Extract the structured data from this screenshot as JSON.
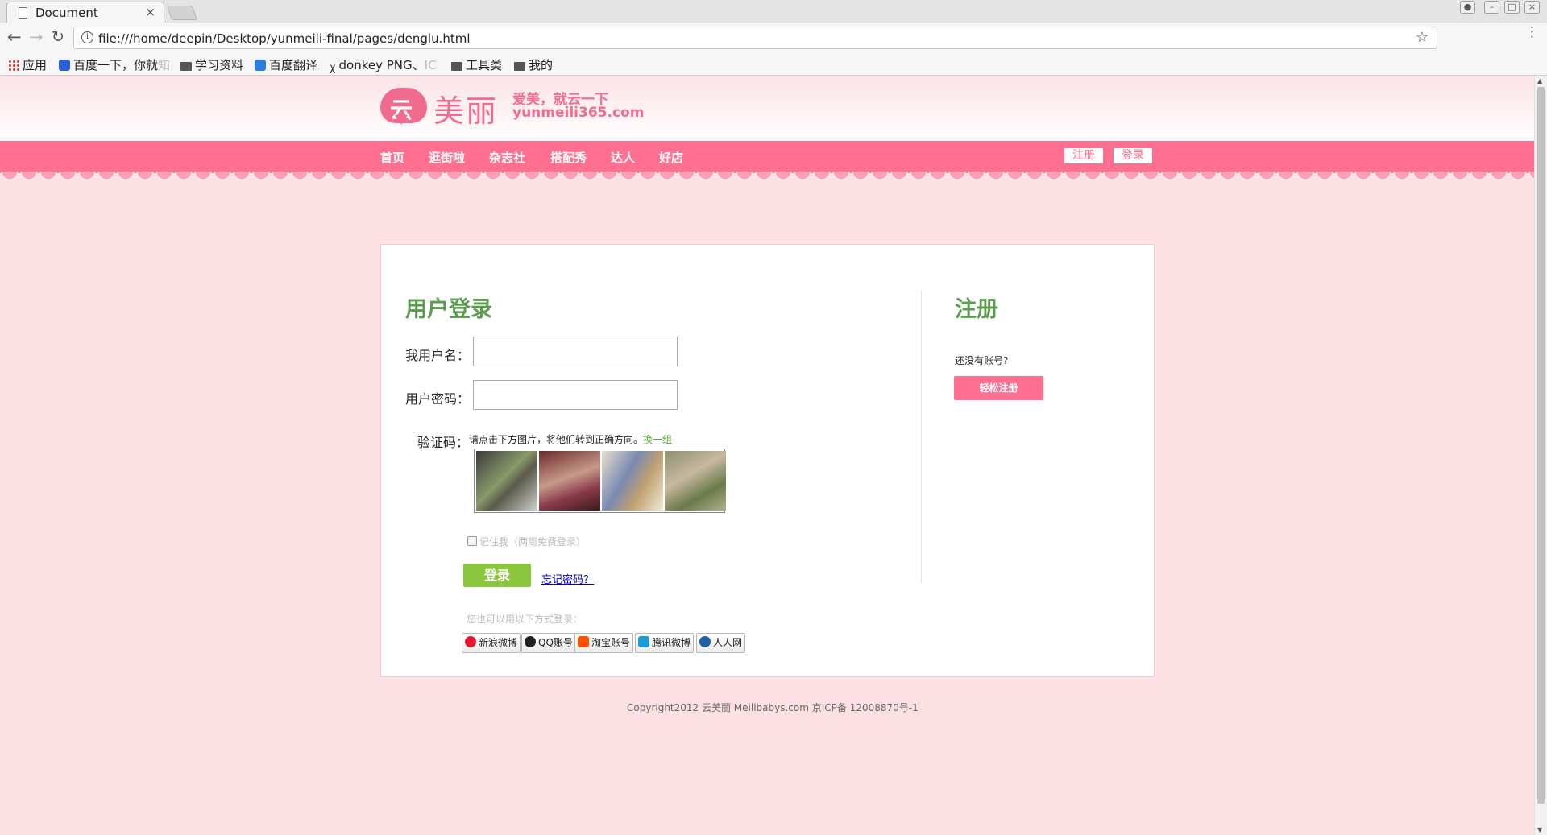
{
  "browser": {
    "tab_title": "Document",
    "tab_close": "×",
    "url": "file:///home/deepin/Desktop/yunmeili-final/pages/denglu.html",
    "bookmarks": [
      {
        "label": "应用",
        "icon": "apps-grid-icon"
      },
      {
        "label": "百度一下，你就",
        "faded": "知",
        "icon": "baidu-paw-icon"
      },
      {
        "label": "学习资料",
        "icon": "folder-icon"
      },
      {
        "label": "百度翻译",
        "icon": "baidu-translate-icon"
      },
      {
        "label": "donkey PNG、",
        "faded": "IC",
        "icon": "donkey-icon"
      },
      {
        "label": "工具类",
        "icon": "folder-icon"
      },
      {
        "label": "我的",
        "icon": "folder-icon"
      }
    ]
  },
  "site": {
    "logo_char": "云",
    "logo_text": "美丽",
    "slogan": "爱美，就云一下",
    "domain": "yunmeili365.com",
    "nav": [
      "首页",
      "逛街啦",
      "杂志社",
      "搭配秀",
      "达人",
      "好店"
    ],
    "register_link": "注册",
    "login_link": "登录"
  },
  "login": {
    "title": "用户登录",
    "username_label": "我用户名：",
    "password_label": "用户密码：",
    "username_value": "",
    "password_value": "",
    "captcha_label": "验证码：",
    "captcha_hint": "请点击下方图片，将他们转到正确方向。",
    "captcha_swap": "换一组",
    "remember": "记住我（两周免费登录）",
    "submit": "登录",
    "forgot": "忘记密码？",
    "alt_hint": "您也可以用以下方式登录：",
    "social": [
      {
        "label": "新浪微博",
        "icon": "sina-weibo-icon",
        "color": "#e6162d"
      },
      {
        "label": "QQ账号",
        "icon": "qq-penguin-icon",
        "color": "#222222"
      },
      {
        "label": "淘宝账号",
        "icon": "taobao-icon",
        "color": "#ff5000"
      },
      {
        "label": "腾讯微博",
        "icon": "tencent-weibo-icon",
        "color": "#1d9bd7"
      },
      {
        "label": "人人网",
        "icon": "renren-icon",
        "color": "#1f5fa8"
      }
    ]
  },
  "register": {
    "title": "注册",
    "hint": "还没有账号?",
    "button": "轻松注册"
  },
  "footer": {
    "copyright": "Copyright2012 云美丽 Meilibabys.com 京ICP备 12008870号-1"
  },
  "colors": {
    "brand_pink": "#ff6f8f",
    "title_green": "#5a9d4f",
    "button_green": "#8cc63e",
    "page_bg": "#fde0e3"
  }
}
